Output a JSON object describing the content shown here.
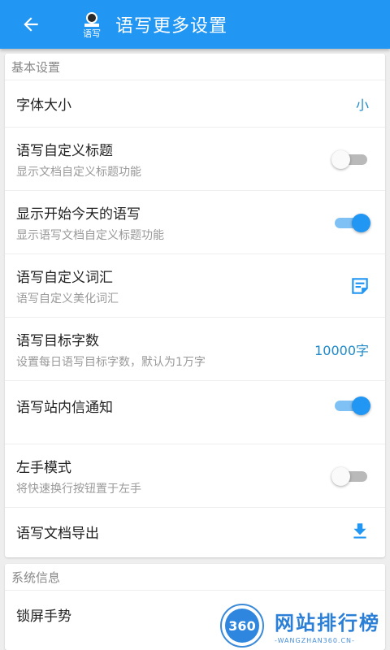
{
  "appbar": {
    "title": "语写更多设置",
    "back_icon": "arrow-left-icon",
    "logo_icon": "app-logo-icon",
    "logo_text": "语写",
    "color": "#2196f3"
  },
  "sections": {
    "basic": {
      "header": "基本设置",
      "font_size": {
        "title": "字体大小",
        "value": "小"
      },
      "custom_title": {
        "title": "语写自定义标题",
        "subtitle": "显示文档自定义标题功能",
        "enabled": false
      },
      "show_today": {
        "title": "显示开始今天的语写",
        "subtitle": "显示语写文档自定义标题功能",
        "enabled": true
      },
      "custom_vocab": {
        "title": "语写自定义词汇",
        "subtitle": "语写自定义美化词汇",
        "icon": "notes-icon"
      },
      "target_words": {
        "title": "语写目标字数",
        "subtitle": "设置每日语写目标字数，默认为1万字",
        "value": "10000字"
      },
      "site_notify": {
        "title": "语写站内信通知",
        "enabled": true
      },
      "left_hand": {
        "title": "左手模式",
        "subtitle": "将快速换行按钮置于左手",
        "enabled": false
      },
      "export": {
        "title": "语写文档导出",
        "icon": "download-icon"
      }
    },
    "system": {
      "header": "系统信息",
      "lock_gesture": {
        "title": "锁屏手势"
      }
    }
  },
  "watermark": {
    "badge": "360",
    "main": "网站排行榜",
    "sub": "-WANGZHAN360.CN-"
  },
  "colors": {
    "accent": "#2196f3",
    "value_text": "#1e88c8",
    "switch_off": "#b9b9b9"
  }
}
